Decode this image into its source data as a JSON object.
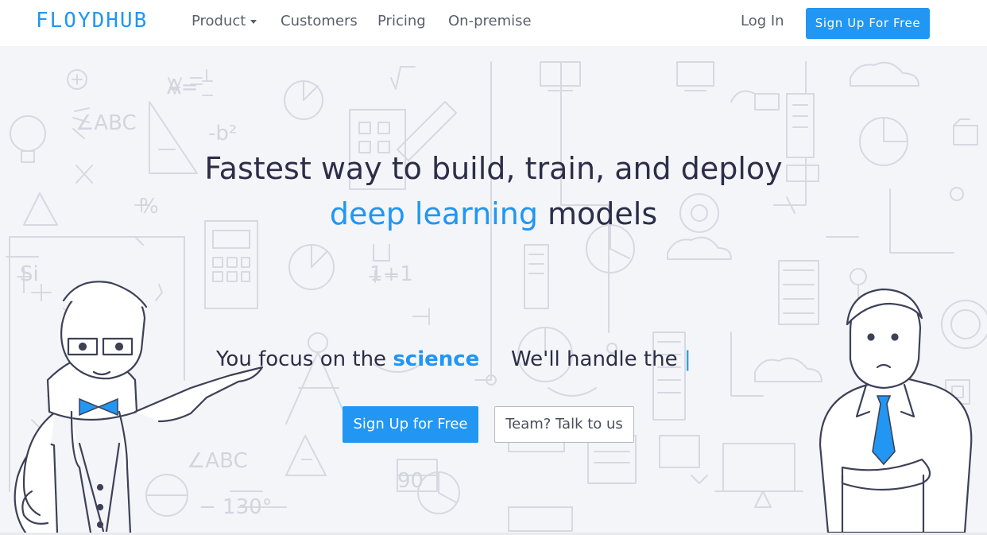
{
  "nav": {
    "logo": "FLOYDHUB",
    "links": [
      {
        "label": "Product",
        "has_dropdown": true
      },
      {
        "label": "Customers"
      },
      {
        "label": "Pricing"
      },
      {
        "label": "On-premise"
      }
    ],
    "login": "Log In",
    "signup": "Sign Up For Free"
  },
  "hero": {
    "headline_line1": "Fastest way to build, train, and deploy",
    "headline_highlight": "deep learning",
    "headline_rest": " models",
    "focus_prefix": "You focus on the ",
    "focus_highlight": "science",
    "handle_prefix": "We'll handle the ",
    "handle_cursor": "|",
    "primary_button": "Sign Up for Free",
    "secondary_button": "Team? Talk to us"
  },
  "colors": {
    "brand": "#2196f3",
    "headline": "#2c2e48",
    "nav_text": "#5b5f6b"
  },
  "icons": [
    "dropdown-caret-icon",
    "background-doodles",
    "scientist-illustration",
    "businessman-illustration"
  ]
}
